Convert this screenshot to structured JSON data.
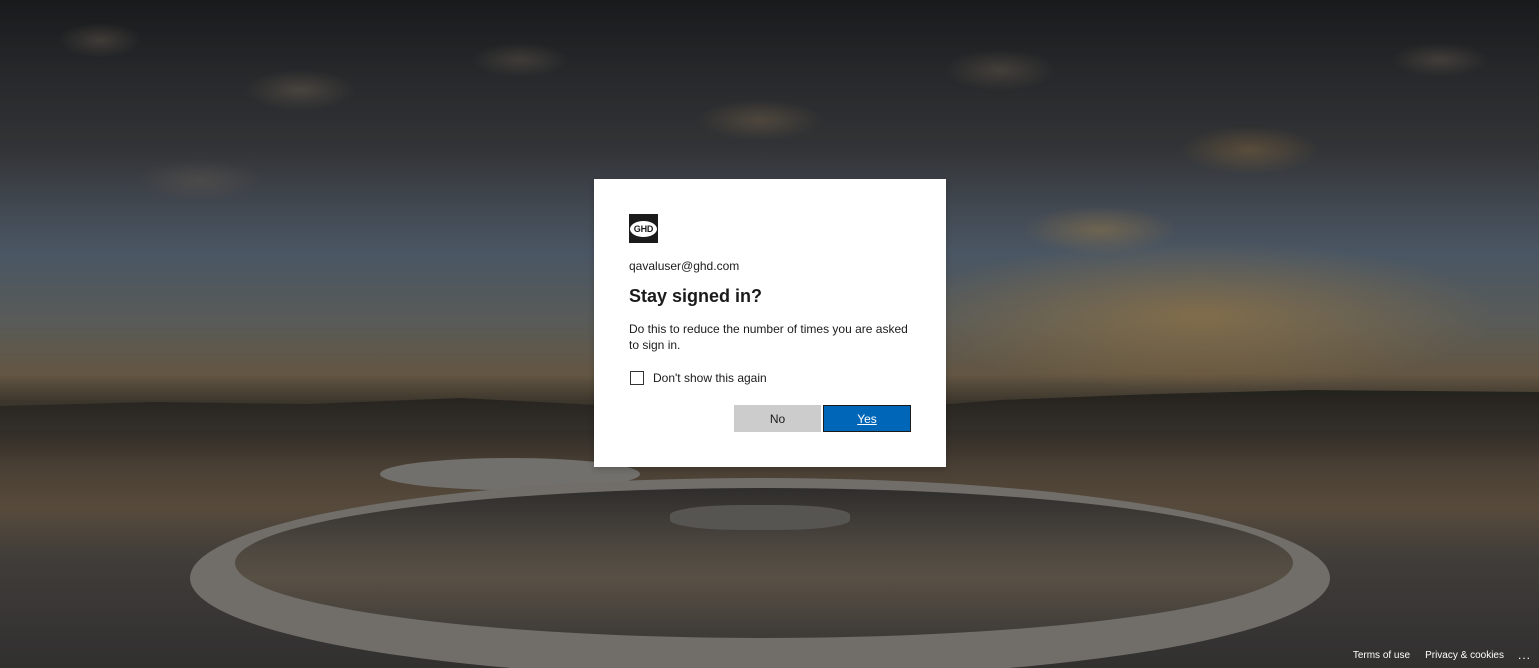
{
  "dialog": {
    "logo_text": "GHD",
    "email": "qavaluser@ghd.com",
    "title": "Stay signed in?",
    "description": "Do this to reduce the number of times you are asked to sign in.",
    "checkbox_label": "Don't show this again",
    "checkbox_checked": false,
    "no_label": "No",
    "yes_label": "Yes"
  },
  "footer": {
    "terms_label": "Terms of use",
    "privacy_label": "Privacy & cookies",
    "more_label": "..."
  },
  "colors": {
    "primary_button": "#0067b8",
    "secondary_button": "#cccccc"
  }
}
